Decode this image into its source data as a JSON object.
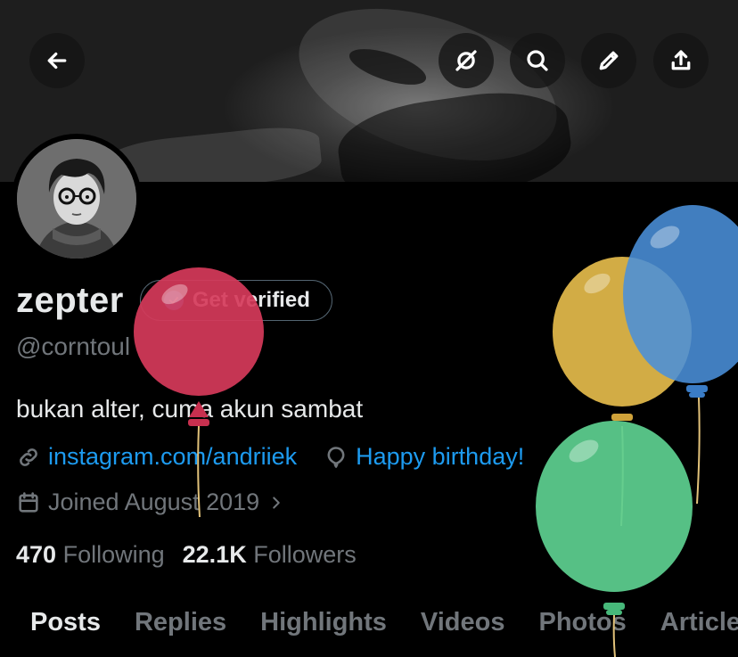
{
  "header": {
    "back_icon": "arrow-left-icon",
    "actions": [
      "grok-icon",
      "search-icon",
      "edit-icon",
      "share-icon"
    ]
  },
  "profile": {
    "display_name": "zepter",
    "verify_label": "Get verified",
    "handle": "@corntoul",
    "bio": "bukan alter, cuma akun sambat",
    "website": "instagram.com/andriiek",
    "birthday": "Happy birthday!",
    "joined": "Joined August 2019",
    "following_count": "470",
    "following_label": "Following",
    "followers_count": "22.1K",
    "followers_label": "Followers"
  },
  "tabs": [
    "Posts",
    "Replies",
    "Highlights",
    "Videos",
    "Photos",
    "Articles"
  ],
  "colors": {
    "accent": "#1d9bf0",
    "muted": "#71767b",
    "balloon_red": "#d63a5a",
    "balloon_yellow": "#e2b94a",
    "balloon_blue": "#4a8fd9",
    "balloon_green": "#5ccf8f"
  }
}
